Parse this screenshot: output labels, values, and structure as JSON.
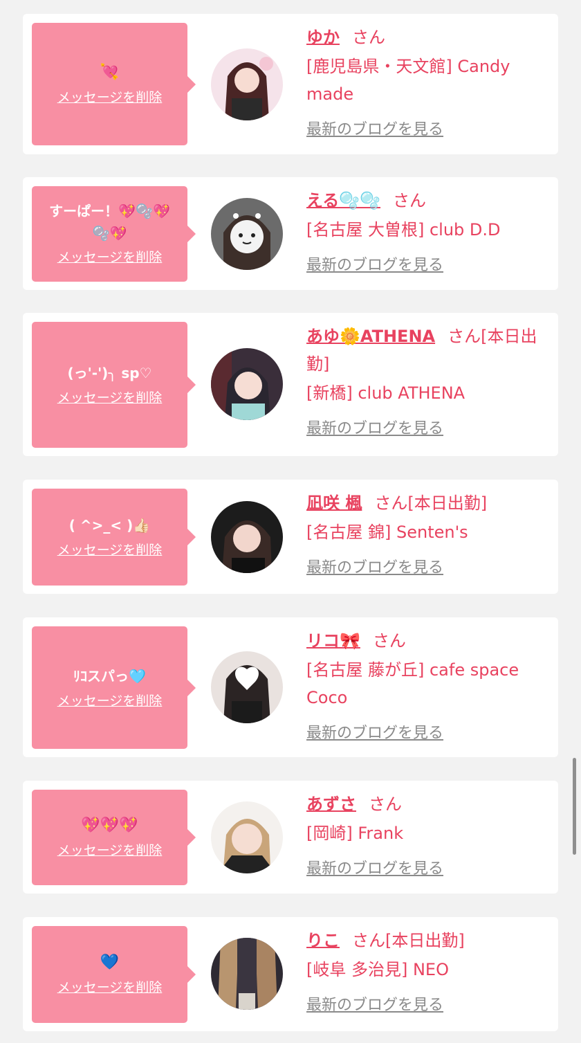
{
  "delete_label": "メッセージを削除",
  "blog_label": "最新のブログを見る",
  "honorific": "さん",
  "cards": [
    {
      "message": "💘",
      "name": "ゆか",
      "status": "",
      "shop": "[鹿児島県・天文館] Candy made"
    },
    {
      "message": "すーぱー！💖🫧💖🫧💖",
      "name": "える🫧🫧",
      "status": "",
      "shop": "[名古屋 大曽根] club D.D"
    },
    {
      "message": "(っ'-')╮ sp♡",
      "name": "あゆ🌼ATHENA",
      "status": "[本日出勤]",
      "shop": "[新橋] club ATHENA"
    },
    {
      "message": "( ^>_< )👍🏻",
      "name": "凪咲 楓",
      "status": "[本日出勤]",
      "shop": "[名古屋 錦] Senten's"
    },
    {
      "message": "ﾘｺスパっ🩵",
      "name": "リコ🎀",
      "status": "",
      "shop": "[名古屋 藤が丘] cafe space Coco"
    },
    {
      "message": "💖💖💖",
      "name": "あずさ",
      "status": "",
      "shop": "[岡崎] Frank"
    },
    {
      "message": "💙",
      "name": "りこ",
      "status": "[本日出勤]",
      "shop": "[岐阜 多治見] NEO"
    }
  ],
  "colors": {
    "bubble": "#f88fa3",
    "accent": "#e8425f",
    "link_gray": "#8a8a8a",
    "background": "#f2f2f2"
  }
}
